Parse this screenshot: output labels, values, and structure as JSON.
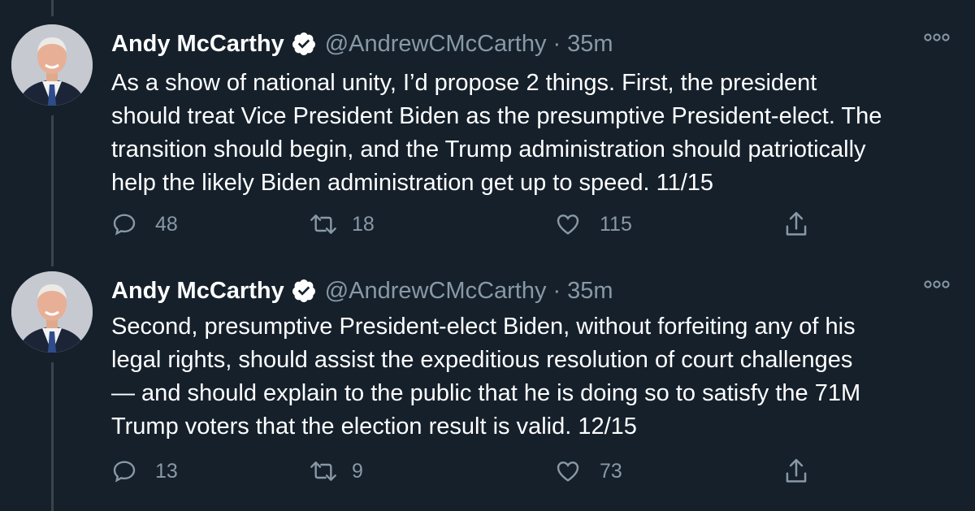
{
  "tweets": [
    {
      "author_name": "Andy McCarthy",
      "handle": "@AndrewCMcCarthy",
      "separator": "·",
      "time": "35m",
      "text": "As a show of national unity, I’d propose 2 things. First, the president\nshould treat Vice President Biden as the presumptive President-elect. The\ntransition should begin, and the Trump administration should patriotically\nhelp the likely Biden administration get up to speed. 11/15",
      "replies": "48",
      "retweets": "18",
      "likes": "115"
    },
    {
      "author_name": "Andy McCarthy",
      "handle": "@AndrewCMcCarthy",
      "separator": "·",
      "time": "35m",
      "text": "Second, presumptive President-elect Biden, without forfeiting any of his\nlegal rights, should assist the expeditious resolution of court challenges\n— and should explain to the public that he is doing so to satisfy the 71M\nTrump voters that the election result is valid. 12/15",
      "replies": "13",
      "retweets": "9",
      "likes": "73"
    }
  ],
  "icons": [
    "verified-badge-icon",
    "more-options-icon",
    "reply-icon",
    "retweet-icon",
    "like-icon",
    "share-icon"
  ],
  "colors": {
    "background": "#15202b",
    "secondary_text": "#8899a6",
    "thread_line": "#38444d",
    "primary_text": "#ffffff"
  }
}
